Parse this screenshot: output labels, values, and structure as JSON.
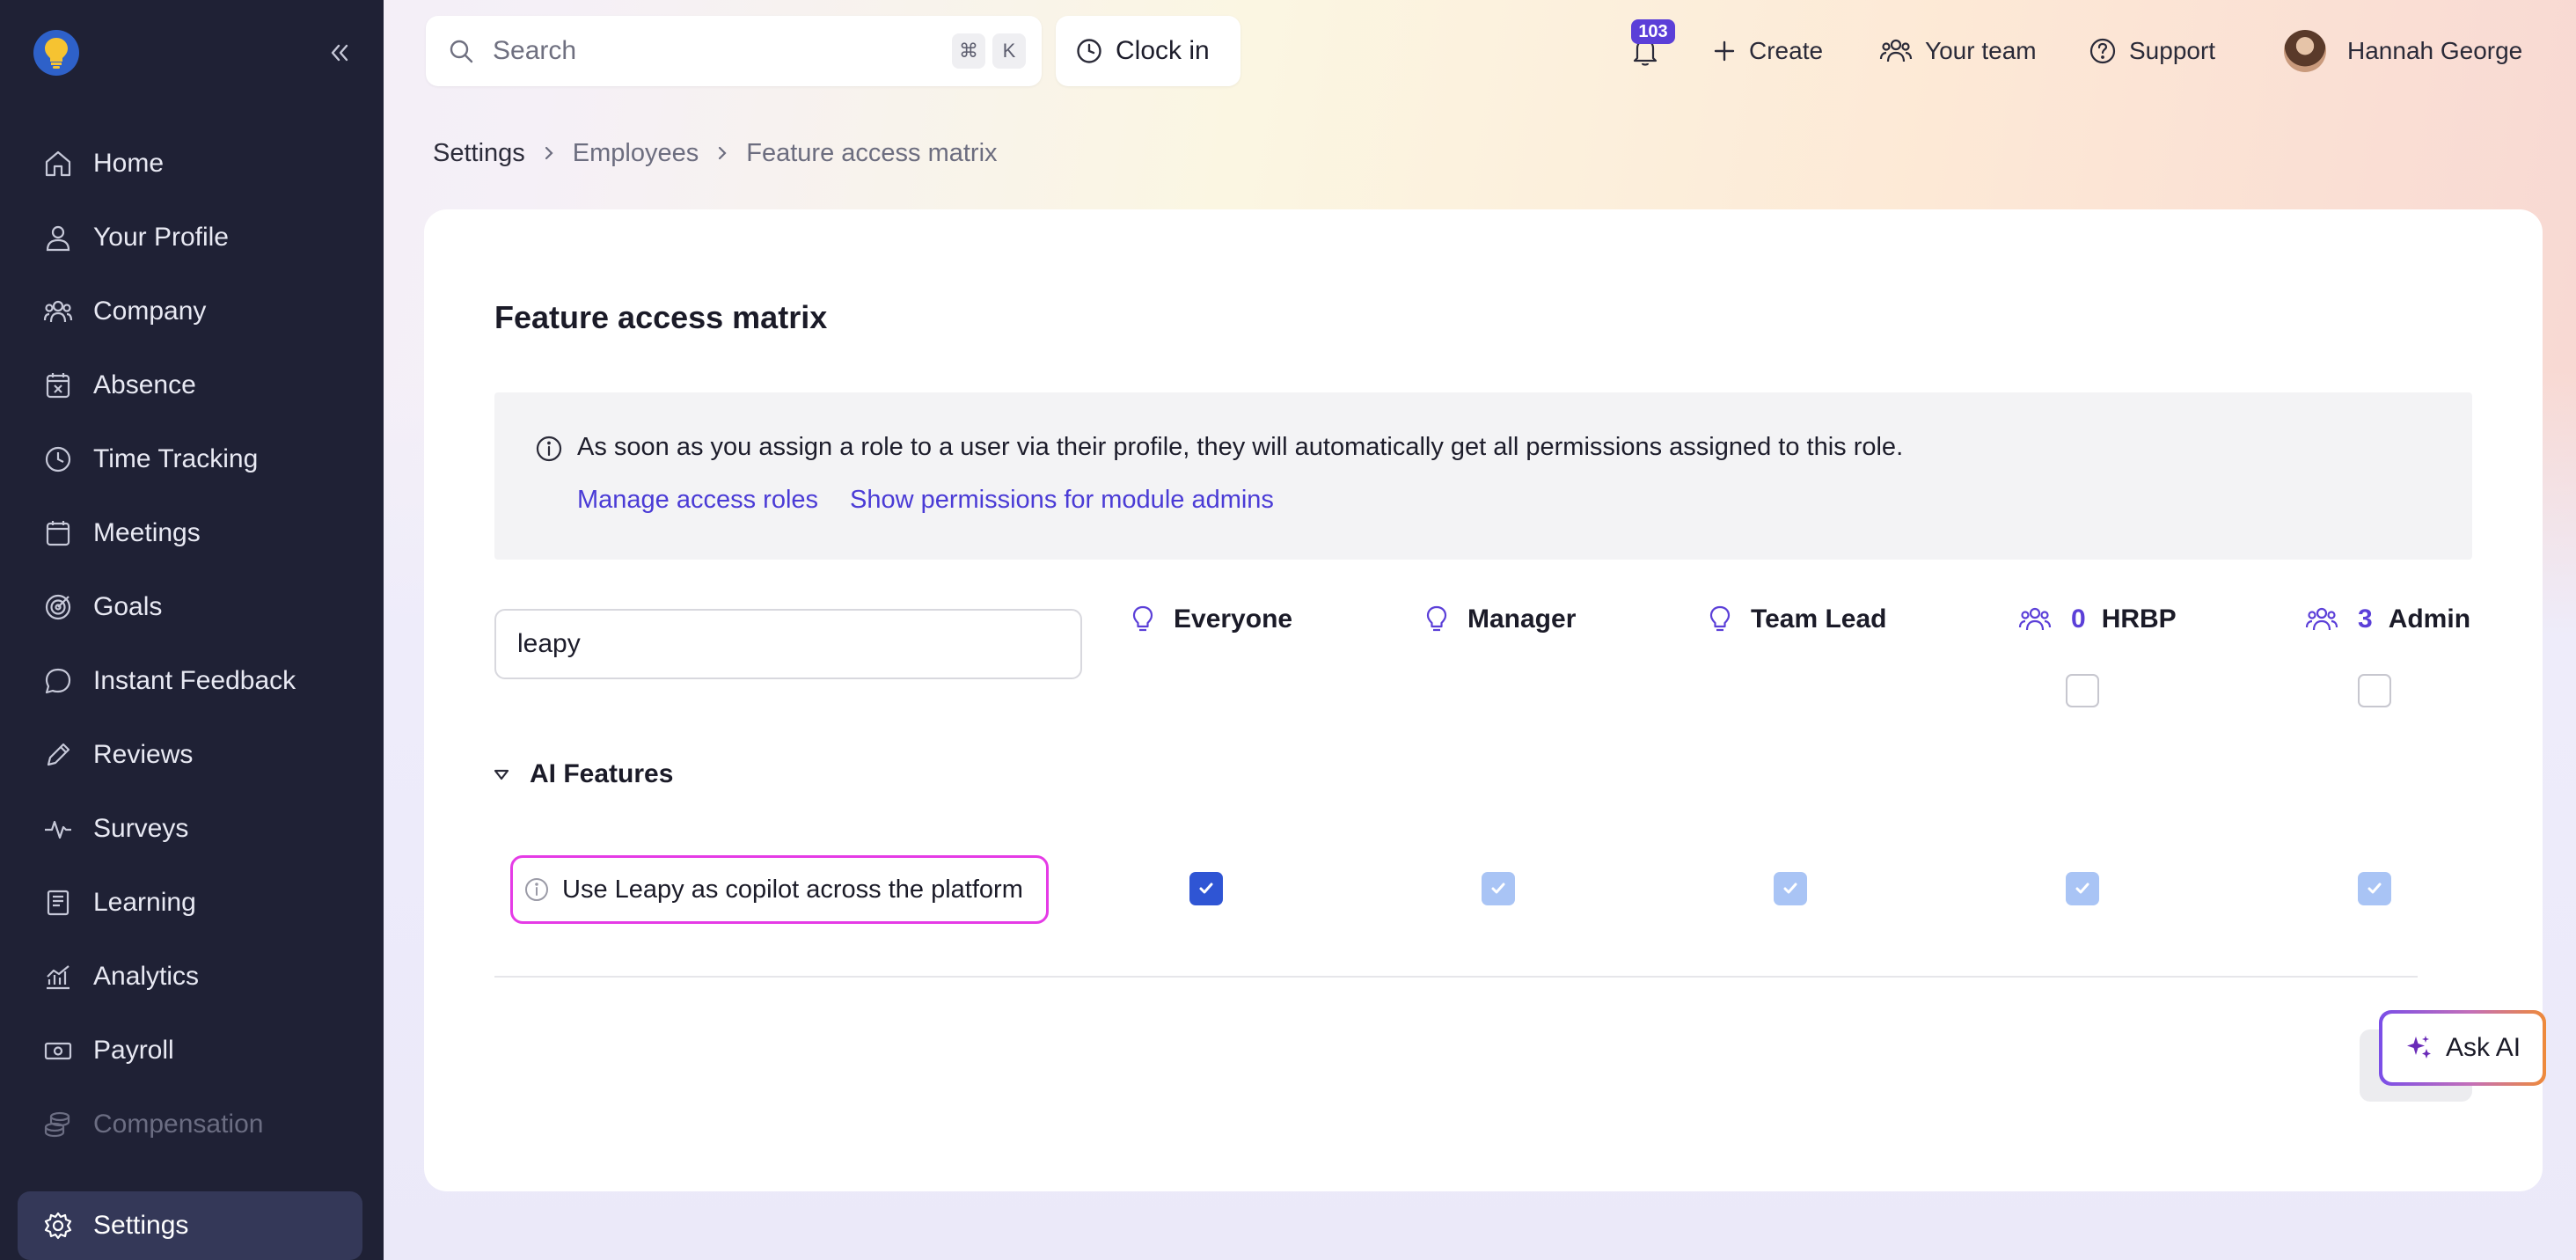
{
  "sidebar": {
    "items": [
      {
        "label": "Home",
        "icon": "home-icon"
      },
      {
        "label": "Your Profile",
        "icon": "user-icon"
      },
      {
        "label": "Company",
        "icon": "people-icon"
      },
      {
        "label": "Absence",
        "icon": "calendar-x-icon"
      },
      {
        "label": "Time Tracking",
        "icon": "clock-icon"
      },
      {
        "label": "Meetings",
        "icon": "calendar-icon"
      },
      {
        "label": "Goals",
        "icon": "target-icon"
      },
      {
        "label": "Instant Feedback",
        "icon": "chat-icon"
      },
      {
        "label": "Reviews",
        "icon": "pencil-icon"
      },
      {
        "label": "Surveys",
        "icon": "pulse-icon"
      },
      {
        "label": "Learning",
        "icon": "book-icon"
      },
      {
        "label": "Analytics",
        "icon": "chart-icon"
      },
      {
        "label": "Payroll",
        "icon": "money-icon"
      },
      {
        "label": "Compensation",
        "icon": "coins-icon",
        "disabled": true
      }
    ],
    "active": {
      "label": "Settings",
      "icon": "gear-icon"
    }
  },
  "topbar": {
    "search_placeholder": "Search",
    "shortcut_mod": "⌘",
    "shortcut_key": "K",
    "clock_in": "Clock in",
    "notifications_count": "103",
    "create": "Create",
    "your_team": "Your team",
    "support": "Support",
    "user_name": "Hannah George"
  },
  "breadcrumb": [
    "Settings",
    "Employees",
    "Feature access matrix"
  ],
  "page": {
    "title": "Feature access matrix",
    "notice_text": "As soon as you assign a role to a user via their profile, they will automatically get all permissions assigned to this role.",
    "link_manage": "Manage access roles",
    "link_module_admins": "Show permissions for module admins",
    "filter_value": "leapy"
  },
  "columns": [
    {
      "label": "Everyone",
      "type": "default-role"
    },
    {
      "label": "Manager",
      "type": "default-role"
    },
    {
      "label": "Team Lead",
      "type": "default-role"
    },
    {
      "label": "HRBP",
      "type": "group",
      "count": "0"
    },
    {
      "label": "Admin",
      "type": "group",
      "count": "3"
    }
  ],
  "section": {
    "label": "AI Features",
    "expanded": true
  },
  "features": [
    {
      "label": "Use Leapy as copilot across the platform",
      "states": [
        "checked",
        "inherited",
        "inherited",
        "inherited",
        "inherited"
      ]
    }
  ],
  "ask_ai": "Ask AI",
  "colors": {
    "sidebar_bg": "#1f2135",
    "accent": "#5b3fd8",
    "link": "#4a3bd6",
    "checkbox_checked": "#2f55d4",
    "checkbox_inherited": "#a9c4f5",
    "highlight": "#e53be6"
  }
}
